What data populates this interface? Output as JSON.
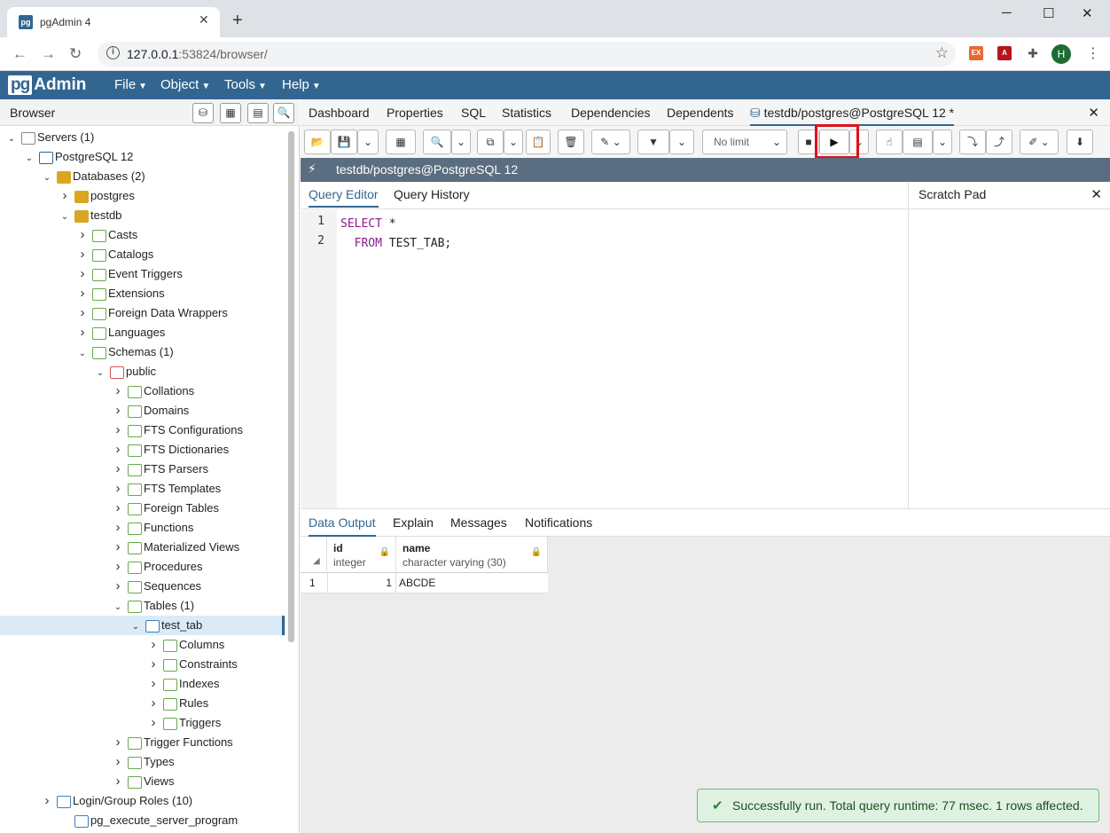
{
  "window": {
    "tab_title": "pgAdmin 4",
    "favicon": "pg",
    "url_host": "127.0.0.1",
    "url_rest": ":53824/browser/"
  },
  "extensions": {
    "avatar": "H"
  },
  "menubar": {
    "logo_pg": "pg",
    "logo_admin": "Admin",
    "items": [
      "File",
      "Object",
      "Tools",
      "Help"
    ]
  },
  "browser": {
    "title": "Browser",
    "tree": [
      {
        "label": "Servers (1)",
        "icon": "servers-icon"
      },
      {
        "label": "PostgreSQL 12",
        "icon": "elephant-icon"
      },
      {
        "label": "Databases (2)",
        "icon": "databases-icon"
      },
      {
        "label": "postgres",
        "icon": "database-icon"
      },
      {
        "label": "testdb",
        "icon": "database-icon"
      },
      {
        "label": "Casts",
        "icon": "casts-icon"
      },
      {
        "label": "Catalogs",
        "icon": "catalogs-icon"
      },
      {
        "label": "Event Triggers",
        "icon": "event-triggers-icon"
      },
      {
        "label": "Extensions",
        "icon": "extensions-icon"
      },
      {
        "label": "Foreign Data Wrappers",
        "icon": "fdw-icon"
      },
      {
        "label": "Languages",
        "icon": "languages-icon"
      },
      {
        "label": "Schemas (1)",
        "icon": "schemas-icon"
      },
      {
        "label": "public",
        "icon": "schema-icon"
      },
      {
        "label": "Collations",
        "icon": "collations-icon"
      },
      {
        "label": "Domains",
        "icon": "domains-icon"
      },
      {
        "label": "FTS Configurations",
        "icon": "fts-config-icon"
      },
      {
        "label": "FTS Dictionaries",
        "icon": "fts-dict-icon"
      },
      {
        "label": "FTS Parsers",
        "icon": "fts-parser-icon"
      },
      {
        "label": "FTS Templates",
        "icon": "fts-template-icon"
      },
      {
        "label": "Foreign Tables",
        "icon": "foreign-tables-icon"
      },
      {
        "label": "Functions",
        "icon": "functions-icon"
      },
      {
        "label": "Materialized Views",
        "icon": "matviews-icon"
      },
      {
        "label": "Procedures",
        "icon": "procedures-icon"
      },
      {
        "label": "Sequences",
        "icon": "sequences-icon"
      },
      {
        "label": "Tables (1)",
        "icon": "tables-icon"
      },
      {
        "label": "test_tab",
        "icon": "table-icon"
      },
      {
        "label": "Columns",
        "icon": "columns-icon"
      },
      {
        "label": "Constraints",
        "icon": "constraints-icon"
      },
      {
        "label": "Indexes",
        "icon": "indexes-icon"
      },
      {
        "label": "Rules",
        "icon": "rules-icon"
      },
      {
        "label": "Triggers",
        "icon": "triggers-icon"
      },
      {
        "label": "Trigger Functions",
        "icon": "trigger-functions-icon"
      },
      {
        "label": "Types",
        "icon": "types-icon"
      },
      {
        "label": "Views",
        "icon": "views-icon"
      },
      {
        "label": "Login/Group Roles (10)",
        "icon": "roles-icon"
      },
      {
        "label": "pg_execute_server_program",
        "icon": "role-icon"
      }
    ]
  },
  "main_tabs": [
    "Dashboard",
    "Properties",
    "SQL",
    "Statistics",
    "Dependencies",
    "Dependents",
    "testdb/postgres@PostgreSQL 12 *"
  ],
  "toolbar": {
    "limit": "No limit"
  },
  "connection": {
    "label": "testdb/postgres@PostgreSQL 12"
  },
  "editor": {
    "tabs": [
      "Query Editor",
      "Query History"
    ],
    "line_numbers": [
      "1",
      "2"
    ],
    "line1_kw": "SELECT",
    "line1_rest": " *",
    "line2_kw": "  FROM",
    "line2_rest": " TEST_TAB;"
  },
  "scratch": {
    "title": "Scratch Pad"
  },
  "output": {
    "tabs": [
      "Data Output",
      "Explain",
      "Messages",
      "Notifications"
    ],
    "columns": [
      {
        "name": "id",
        "type": "integer"
      },
      {
        "name": "name",
        "type": "character varying (30)"
      }
    ],
    "rows": [
      {
        "num": "1",
        "id": "1",
        "name": "ABCDE"
      }
    ]
  },
  "toast": {
    "message": "Successfully run. Total query runtime: 77 msec. 1 rows affected."
  },
  "colors": {
    "brand": "#326690",
    "highlight": "#e0101a",
    "success": "#dff2e1"
  }
}
